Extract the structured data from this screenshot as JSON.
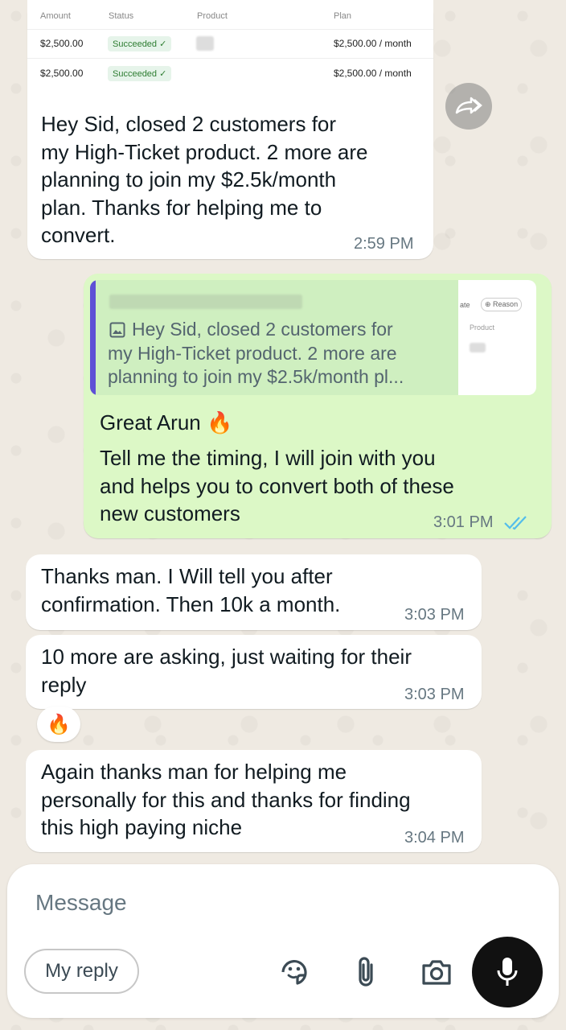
{
  "screenshot_table": {
    "headers": [
      "Amount",
      "Status",
      "Product",
      "Plan"
    ],
    "rows": [
      {
        "amount": "$2,500.00",
        "status": "Succeeded ✓",
        "plan": "$2,500.00 / month"
      },
      {
        "amount": "$2,500.00",
        "status": "Succeeded ✓",
        "plan": "$2,500.00 / month"
      }
    ]
  },
  "messages": [
    {
      "text": "Hey Sid, closed 2 customers for\nmy High-Ticket product. 2 more are\nplanning to join my $2.5k/month\nplan. Thanks for helping me to\nconvert.",
      "time": "2:59 PM"
    },
    {
      "quote": "Hey Sid, closed 2 customers for\nmy High-Ticket product. 2 more are\nplanning to join my $2.5k/month pl...",
      "quote_thumb_labels": [
        "ate",
        "Reason",
        "Product"
      ],
      "text_line1": "Great Arun 🔥",
      "text": "Tell me the timing, I will join with you\nand helps you to convert both of these\nnew customers",
      "time": "3:01 PM"
    },
    {
      "text": "Thanks man. I Will tell you after\nconfirmation. Then 10k a month.",
      "time": "3:03 PM"
    },
    {
      "text": "10 more are asking, just waiting for their\nreply",
      "time": "3:03 PM"
    },
    {
      "text": "Again thanks man for helping me\npersonally for this and thanks for finding\nthis high paying niche",
      "time": "3:04 PM"
    }
  ],
  "reaction": "🔥",
  "composer": {
    "placeholder": "Message",
    "chip": "My reply"
  },
  "colors": {
    "incoming": "#ffffff",
    "outgoing": "#DCF8C6",
    "quote_bar": "#5E4FD6",
    "read_ticks": "#53BDEB"
  },
  "icons": [
    "forward-icon",
    "image-icon",
    "double-check-icon",
    "sticker-icon",
    "attach-icon",
    "camera-icon",
    "mic-icon"
  ]
}
